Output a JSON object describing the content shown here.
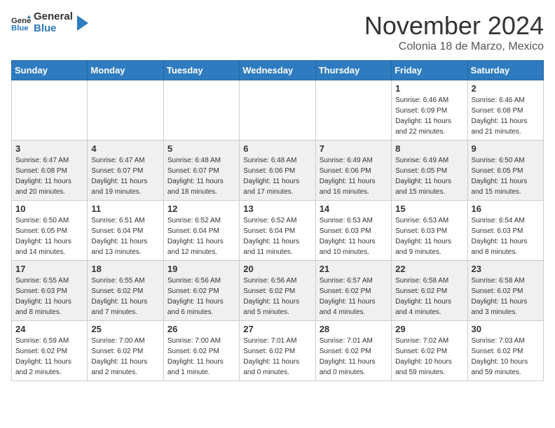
{
  "header": {
    "logo_line1": "General",
    "logo_line2": "Blue",
    "month": "November 2024",
    "location": "Colonia 18 de Marzo, Mexico"
  },
  "weekdays": [
    "Sunday",
    "Monday",
    "Tuesday",
    "Wednesday",
    "Thursday",
    "Friday",
    "Saturday"
  ],
  "weeks": [
    [
      {
        "day": "",
        "info": ""
      },
      {
        "day": "",
        "info": ""
      },
      {
        "day": "",
        "info": ""
      },
      {
        "day": "",
        "info": ""
      },
      {
        "day": "",
        "info": ""
      },
      {
        "day": "1",
        "info": "Sunrise: 6:46 AM\nSunset: 6:09 PM\nDaylight: 11 hours\nand 22 minutes."
      },
      {
        "day": "2",
        "info": "Sunrise: 6:46 AM\nSunset: 6:08 PM\nDaylight: 11 hours\nand 21 minutes."
      }
    ],
    [
      {
        "day": "3",
        "info": "Sunrise: 6:47 AM\nSunset: 6:08 PM\nDaylight: 11 hours\nand 20 minutes."
      },
      {
        "day": "4",
        "info": "Sunrise: 6:47 AM\nSunset: 6:07 PM\nDaylight: 11 hours\nand 19 minutes."
      },
      {
        "day": "5",
        "info": "Sunrise: 6:48 AM\nSunset: 6:07 PM\nDaylight: 11 hours\nand 18 minutes."
      },
      {
        "day": "6",
        "info": "Sunrise: 6:48 AM\nSunset: 6:06 PM\nDaylight: 11 hours\nand 17 minutes."
      },
      {
        "day": "7",
        "info": "Sunrise: 6:49 AM\nSunset: 6:06 PM\nDaylight: 11 hours\nand 16 minutes."
      },
      {
        "day": "8",
        "info": "Sunrise: 6:49 AM\nSunset: 6:05 PM\nDaylight: 11 hours\nand 15 minutes."
      },
      {
        "day": "9",
        "info": "Sunrise: 6:50 AM\nSunset: 6:05 PM\nDaylight: 11 hours\nand 15 minutes."
      }
    ],
    [
      {
        "day": "10",
        "info": "Sunrise: 6:50 AM\nSunset: 6:05 PM\nDaylight: 11 hours\nand 14 minutes."
      },
      {
        "day": "11",
        "info": "Sunrise: 6:51 AM\nSunset: 6:04 PM\nDaylight: 11 hours\nand 13 minutes."
      },
      {
        "day": "12",
        "info": "Sunrise: 6:52 AM\nSunset: 6:04 PM\nDaylight: 11 hours\nand 12 minutes."
      },
      {
        "day": "13",
        "info": "Sunrise: 6:52 AM\nSunset: 6:04 PM\nDaylight: 11 hours\nand 11 minutes."
      },
      {
        "day": "14",
        "info": "Sunrise: 6:53 AM\nSunset: 6:03 PM\nDaylight: 11 hours\nand 10 minutes."
      },
      {
        "day": "15",
        "info": "Sunrise: 6:53 AM\nSunset: 6:03 PM\nDaylight: 11 hours\nand 9 minutes."
      },
      {
        "day": "16",
        "info": "Sunrise: 6:54 AM\nSunset: 6:03 PM\nDaylight: 11 hours\nand 8 minutes."
      }
    ],
    [
      {
        "day": "17",
        "info": "Sunrise: 6:55 AM\nSunset: 6:03 PM\nDaylight: 11 hours\nand 8 minutes."
      },
      {
        "day": "18",
        "info": "Sunrise: 6:55 AM\nSunset: 6:02 PM\nDaylight: 11 hours\nand 7 minutes."
      },
      {
        "day": "19",
        "info": "Sunrise: 6:56 AM\nSunset: 6:02 PM\nDaylight: 11 hours\nand 6 minutes."
      },
      {
        "day": "20",
        "info": "Sunrise: 6:56 AM\nSunset: 6:02 PM\nDaylight: 11 hours\nand 5 minutes."
      },
      {
        "day": "21",
        "info": "Sunrise: 6:57 AM\nSunset: 6:02 PM\nDaylight: 11 hours\nand 4 minutes."
      },
      {
        "day": "22",
        "info": "Sunrise: 6:58 AM\nSunset: 6:02 PM\nDaylight: 11 hours\nand 4 minutes."
      },
      {
        "day": "23",
        "info": "Sunrise: 6:58 AM\nSunset: 6:02 PM\nDaylight: 11 hours\nand 3 minutes."
      }
    ],
    [
      {
        "day": "24",
        "info": "Sunrise: 6:59 AM\nSunset: 6:02 PM\nDaylight: 11 hours\nand 2 minutes."
      },
      {
        "day": "25",
        "info": "Sunrise: 7:00 AM\nSunset: 6:02 PM\nDaylight: 11 hours\nand 2 minutes."
      },
      {
        "day": "26",
        "info": "Sunrise: 7:00 AM\nSunset: 6:02 PM\nDaylight: 11 hours\nand 1 minute."
      },
      {
        "day": "27",
        "info": "Sunrise: 7:01 AM\nSunset: 6:02 PM\nDaylight: 11 hours\nand 0 minutes."
      },
      {
        "day": "28",
        "info": "Sunrise: 7:01 AM\nSunset: 6:02 PM\nDaylight: 11 hours\nand 0 minutes."
      },
      {
        "day": "29",
        "info": "Sunrise: 7:02 AM\nSunset: 6:02 PM\nDaylight: 10 hours\nand 59 minutes."
      },
      {
        "day": "30",
        "info": "Sunrise: 7:03 AM\nSunset: 6:02 PM\nDaylight: 10 hours\nand 59 minutes."
      }
    ]
  ]
}
